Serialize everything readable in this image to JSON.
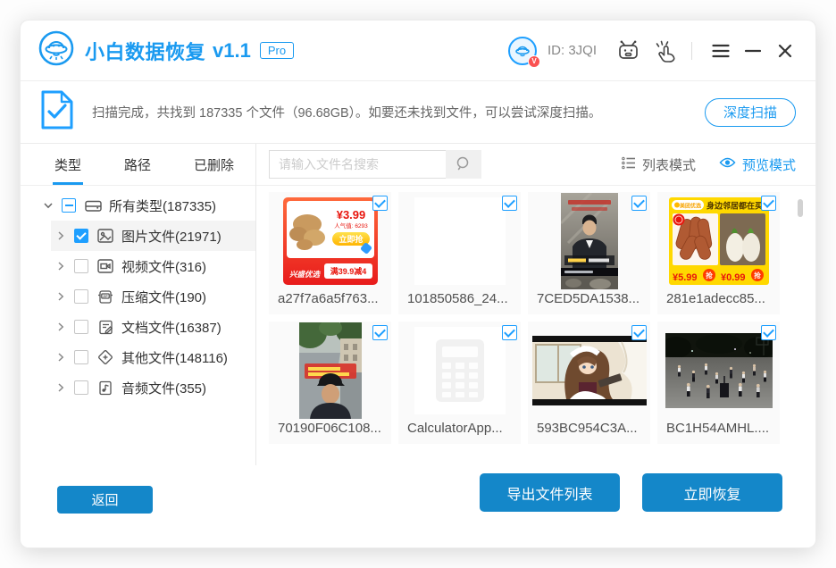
{
  "titlebar": {
    "app_name": "小白数据恢复",
    "version": "v1.1",
    "pro_badge": "Pro",
    "avatar_badge": "V",
    "user_id": "ID: 3JQI"
  },
  "scan_bar": {
    "message": "扫描完成，共找到 187335 个文件（96.68GB）。如要还未找到文件，可以尝试深度扫描。",
    "deep_scan_button": "深度扫描"
  },
  "sidebar": {
    "tabs": [
      {
        "label": "类型",
        "active": true
      },
      {
        "label": "路径",
        "active": false
      },
      {
        "label": "已删除",
        "active": false
      }
    ],
    "tree": [
      {
        "label": "所有类型(187335)",
        "icon": "drive-icon",
        "checkbox": "indeterminate",
        "expanded": true,
        "selected": false
      },
      {
        "label": "图片文件(21971)",
        "icon": "image-icon",
        "checkbox": "checked",
        "expanded": false,
        "selected": true
      },
      {
        "label": "视频文件(316)",
        "icon": "video-icon",
        "checkbox": "unchecked",
        "expanded": false,
        "selected": false
      },
      {
        "label": "压缩文件(190)",
        "icon": "zip-icon",
        "checkbox": "unchecked",
        "expanded": false,
        "selected": false
      },
      {
        "label": "文档文件(16387)",
        "icon": "document-icon",
        "checkbox": "unchecked",
        "expanded": false,
        "selected": false
      },
      {
        "label": "其他文件(148116)",
        "icon": "other-icon",
        "checkbox": "unchecked",
        "expanded": false,
        "selected": false
      },
      {
        "label": "音频文件(355)",
        "icon": "audio-icon",
        "checkbox": "unchecked",
        "expanded": false,
        "selected": false
      }
    ]
  },
  "main": {
    "search_placeholder": "请输入文件名搜索",
    "list_mode_label": "列表模式",
    "preview_mode_label": "预览模式",
    "active_mode": "preview",
    "files": [
      {
        "name": "a27f7a6a5f763...",
        "checked": true,
        "thumb_text": {
          "price": "¥3.99",
          "popularity": "人气值: 6293",
          "buy": "立即抢",
          "brand": "兴盛优选",
          "coupon": "满39.9减4"
        }
      },
      {
        "name": "101850586_24...",
        "checked": true
      },
      {
        "name": "7CED5DA1538...",
        "checked": true
      },
      {
        "name": "281e1adecc85...",
        "checked": true,
        "thumb_text": {
          "brand": "美团优选",
          "banner": "身边邻居都在买",
          "price_left": "¥5.99",
          "price_right": "¥0.99",
          "grab": "抢"
        }
      },
      {
        "name": "70190F06C108...",
        "checked": true
      },
      {
        "name": "CalculatorApp...",
        "checked": true
      },
      {
        "name": "593BC954C3A...",
        "checked": true
      },
      {
        "name": "BC1H54AMHL....",
        "checked": true
      }
    ]
  },
  "footer": {
    "back_button": "返回",
    "export_button": "导出文件列表",
    "recover_button": "立即恢复"
  },
  "colors": {
    "accent_blue": "#1a9af0",
    "button_blue": "#1487c9",
    "checkbox_blue": "#1e9fff",
    "badge_red": "#fa5151"
  }
}
